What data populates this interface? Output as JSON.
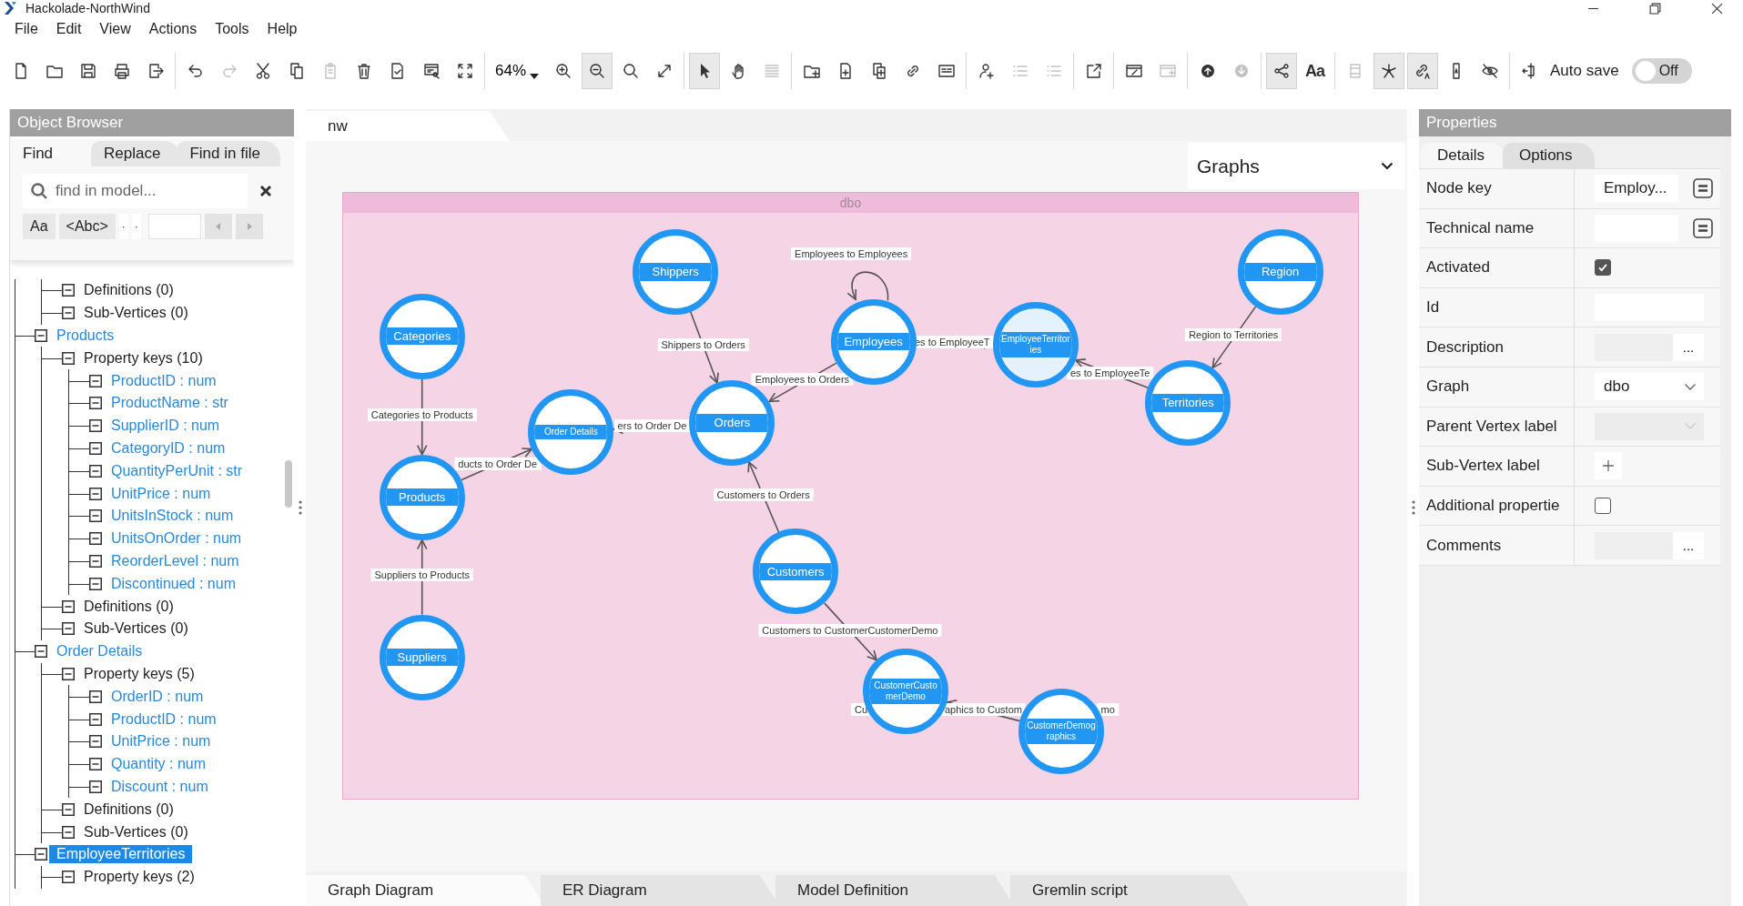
{
  "window": {
    "title": "Hackolade-NorthWind"
  },
  "menu": [
    "File",
    "Edit",
    "View",
    "Actions",
    "Tools",
    "Help"
  ],
  "toolbar": [
    {
      "kind": "file",
      "disabled": false,
      "pressed": false
    },
    {
      "kind": "folder",
      "disabled": false,
      "pressed": false
    },
    {
      "kind": "save",
      "disabled": false,
      "pressed": false
    },
    {
      "kind": "printer",
      "disabled": false,
      "pressed": false
    },
    {
      "kind": "export",
      "disabled": false,
      "pressed": false
    },
    {
      "kind": "separator"
    },
    {
      "kind": "undo",
      "disabled": false,
      "pressed": false
    },
    {
      "kind": "redo",
      "disabled": true,
      "pressed": false
    },
    {
      "kind": "scissors",
      "disabled": false,
      "pressed": false
    },
    {
      "kind": "copy",
      "disabled": false,
      "pressed": false
    },
    {
      "kind": "paste",
      "disabled": true,
      "pressed": false
    },
    {
      "kind": "trash",
      "disabled": false,
      "pressed": false
    },
    {
      "kind": "doc-check",
      "disabled": false,
      "pressed": false
    },
    {
      "kind": "report",
      "disabled": false,
      "pressed": false
    },
    {
      "kind": "fit-screen",
      "disabled": false,
      "pressed": false
    },
    {
      "kind": "separator"
    },
    {
      "kind": "zoom-select",
      "value": "64%"
    },
    {
      "kind": "zoom-in",
      "disabled": false,
      "pressed": false
    },
    {
      "kind": "zoom-out",
      "disabled": false,
      "pressed": true
    },
    {
      "kind": "search",
      "disabled": false,
      "pressed": false
    },
    {
      "kind": "resize",
      "disabled": false,
      "pressed": false
    },
    {
      "kind": "separator"
    },
    {
      "kind": "pointer",
      "disabled": false,
      "pressed": true
    },
    {
      "kind": "hand",
      "disabled": false,
      "pressed": false
    },
    {
      "kind": "lines",
      "disabled": true,
      "pressed": false
    },
    {
      "kind": "separator"
    },
    {
      "kind": "folder-plus",
      "disabled": false,
      "pressed": false
    },
    {
      "kind": "file-plus",
      "disabled": false,
      "pressed": false
    },
    {
      "kind": "copy-plus",
      "disabled": false,
      "pressed": false
    },
    {
      "kind": "link-plus",
      "disabled": false,
      "pressed": false
    },
    {
      "kind": "text-box",
      "disabled": false,
      "pressed": false
    },
    {
      "kind": "separator"
    },
    {
      "kind": "user-plus",
      "disabled": false,
      "pressed": false
    },
    {
      "kind": "list",
      "disabled": true,
      "pressed": false
    },
    {
      "kind": "list",
      "disabled": true,
      "pressed": false
    },
    {
      "kind": "separator"
    },
    {
      "kind": "external-link",
      "disabled": false,
      "pressed": false
    },
    {
      "kind": "separator"
    },
    {
      "kind": "window-edit",
      "disabled": false,
      "pressed": false
    },
    {
      "kind": "window-plus",
      "disabled": true,
      "pressed": false
    },
    {
      "kind": "separator"
    },
    {
      "kind": "arrow-up-circle",
      "disabled": false,
      "pressed": false
    },
    {
      "kind": "arrow-down-circle",
      "disabled": true,
      "pressed": false
    },
    {
      "kind": "separator"
    },
    {
      "kind": "share-nodes",
      "disabled": false,
      "pressed": true
    },
    {
      "kind": "font-style",
      "label": "Aa",
      "disabled": false,
      "pressed": false
    },
    {
      "kind": "separator"
    },
    {
      "kind": "film",
      "disabled": true,
      "pressed": false
    },
    {
      "kind": "star-nodes",
      "disabled": false,
      "pressed": true
    },
    {
      "kind": "link-letter",
      "disabled": false,
      "pressed": true
    },
    {
      "kind": "text-vertical",
      "disabled": false,
      "pressed": false
    },
    {
      "kind": "eye-off",
      "disabled": false,
      "pressed": false
    },
    {
      "kind": "separator"
    },
    {
      "kind": "split-align",
      "disabled": false,
      "pressed": false
    }
  ],
  "autosave": {
    "label": "Auto save",
    "on": false,
    "state_text": "Off"
  },
  "object_browser": {
    "title": "Object Browser",
    "find": {
      "tabs": [
        {
          "label": "Find",
          "selected": true
        },
        {
          "label": "Replace",
          "selected": false
        },
        {
          "label": "Find in file",
          "selected": false
        }
      ],
      "placeholder": "find in model...",
      "options": [
        "Aa",
        "<Abc>",
        "·",
        "·"
      ],
      "nav_disabled": true
    },
    "tree": [
      {
        "kind": "continued",
        "children": [
          {
            "kind": "group",
            "label": "Definitions (0)",
            "expanded": true
          },
          {
            "kind": "group",
            "label": "Sub-Vertices (0)",
            "expanded": true
          }
        ]
      },
      {
        "kind": "vertex",
        "label": "Products",
        "selected": false,
        "expanded": true,
        "children": [
          {
            "kind": "group",
            "label": "Property keys (10)",
            "expanded": true,
            "children": [
              {
                "kind": "property",
                "label": "ProductID : num",
                "expanded": true
              },
              {
                "kind": "property",
                "label": "ProductName : str",
                "expanded": true
              },
              {
                "kind": "property",
                "label": "SupplierID : num",
                "expanded": true
              },
              {
                "kind": "property",
                "label": "CategoryID : num",
                "expanded": true
              },
              {
                "kind": "property",
                "label": "QuantityPerUnit : str",
                "expanded": true
              },
              {
                "kind": "property",
                "label": "UnitPrice : num",
                "expanded": true
              },
              {
                "kind": "property",
                "label": "UnitsInStock : num",
                "expanded": true
              },
              {
                "kind": "property",
                "label": "UnitsOnOrder : num",
                "expanded": true
              },
              {
                "kind": "property",
                "label": "ReorderLevel : num",
                "expanded": true
              },
              {
                "kind": "property",
                "label": "Discontinued : num",
                "expanded": true
              }
            ]
          },
          {
            "kind": "group",
            "label": "Definitions (0)",
            "expanded": true
          },
          {
            "kind": "group",
            "label": "Sub-Vertices (0)",
            "expanded": true
          }
        ]
      },
      {
        "kind": "vertex",
        "label": "Order Details",
        "selected": false,
        "expanded": true,
        "children": [
          {
            "kind": "group",
            "label": "Property keys (5)",
            "expanded": true,
            "children": [
              {
                "kind": "property",
                "label": "OrderID : num",
                "expanded": true
              },
              {
                "kind": "property",
                "label": "ProductID : num",
                "expanded": true
              },
              {
                "kind": "property",
                "label": "UnitPrice : num",
                "expanded": true
              },
              {
                "kind": "property",
                "label": "Quantity : num",
                "expanded": true
              },
              {
                "kind": "property",
                "label": "Discount : num",
                "expanded": true
              }
            ]
          },
          {
            "kind": "group",
            "label": "Definitions (0)",
            "expanded": true
          },
          {
            "kind": "group",
            "label": "Sub-Vertices (0)",
            "expanded": true
          }
        ]
      },
      {
        "kind": "vertex",
        "label": "EmployeeTerritories",
        "selected": true,
        "expanded": true,
        "children": [
          {
            "kind": "group",
            "label": "Property keys (2)",
            "expanded": true
          }
        ]
      }
    ]
  },
  "editor": {
    "document_tab": "nw",
    "graph_selector": "Graphs",
    "graph": {
      "title": "dbo",
      "nodes": [
        {
          "label": "Shippers",
          "selected": false
        },
        {
          "label": "Categories",
          "selected": false
        },
        {
          "label": "Employees",
          "selected": false
        },
        {
          "label": "EmployeeTerritories",
          "selected": true
        },
        {
          "label": "Region",
          "selected": false
        },
        {
          "label": "Territories",
          "selected": false
        },
        {
          "label": "Order Details",
          "selected": false
        },
        {
          "label": "Orders",
          "selected": false
        },
        {
          "label": "Products",
          "selected": false
        },
        {
          "label": "Customers",
          "selected": false
        },
        {
          "label": "Suppliers",
          "selected": false
        },
        {
          "label": "CustomerCustomerDemo",
          "selected": false
        },
        {
          "label": "CustomerDemographics",
          "selected": false
        }
      ],
      "edges": [
        {
          "labels": [
            "Employees to Employees"
          ]
        },
        {
          "labels": [
            "Shippers to Orders"
          ]
        },
        {
          "labels": [
            "Employees to Orders"
          ]
        },
        {
          "labels": [
            "es to EmployeeT"
          ]
        },
        {
          "labels": [
            "es to EmployeeTe"
          ]
        },
        {
          "labels": [
            "Region to Territories"
          ]
        },
        {
          "labels": [
            "Categories to Products"
          ]
        },
        {
          "labels": [
            "ducts to Order De"
          ]
        },
        {
          "labels": [
            "ers to Order De"
          ]
        },
        {
          "labels": [
            "Customers to Orders"
          ]
        },
        {
          "labels": [
            "Suppliers to Products"
          ]
        },
        {
          "labels": [
            "Customers to CustomerCustomerDemo"
          ]
        },
        {
          "labels": [
            "Cu",
            "aphics to Custom",
            "mo"
          ]
        }
      ]
    },
    "bottom_tabs": [
      {
        "label": "Graph Diagram",
        "selected": true
      },
      {
        "label": "ER Diagram",
        "selected": false
      },
      {
        "label": "Model Definition",
        "selected": false
      },
      {
        "label": "Gremlin script",
        "selected": false
      }
    ]
  },
  "properties": {
    "title": "Properties",
    "tabs": [
      {
        "label": "Details",
        "selected": true
      },
      {
        "label": "Options",
        "selected": false
      }
    ],
    "rows": [
      {
        "label": "Node key",
        "kind": "list_input",
        "value": "Employ..."
      },
      {
        "label": "Technical name",
        "kind": "list_input"
      },
      {
        "label": "Activated",
        "kind": "checkbox",
        "checked": true
      },
      {
        "label": "Id",
        "kind": "input"
      },
      {
        "label": "Description",
        "kind": "text_more",
        "button_label": "..."
      },
      {
        "label": "Graph",
        "kind": "select",
        "value": "dbo",
        "disabled": false
      },
      {
        "label": "Parent Vertex label",
        "kind": "select",
        "disabled": true
      },
      {
        "label": "Sub-Vertex label",
        "kind": "add"
      },
      {
        "label": "Additional propertie",
        "kind": "checkbox",
        "checked": false
      },
      {
        "label": "Comments",
        "kind": "text_more",
        "button_label": "..."
      }
    ]
  }
}
